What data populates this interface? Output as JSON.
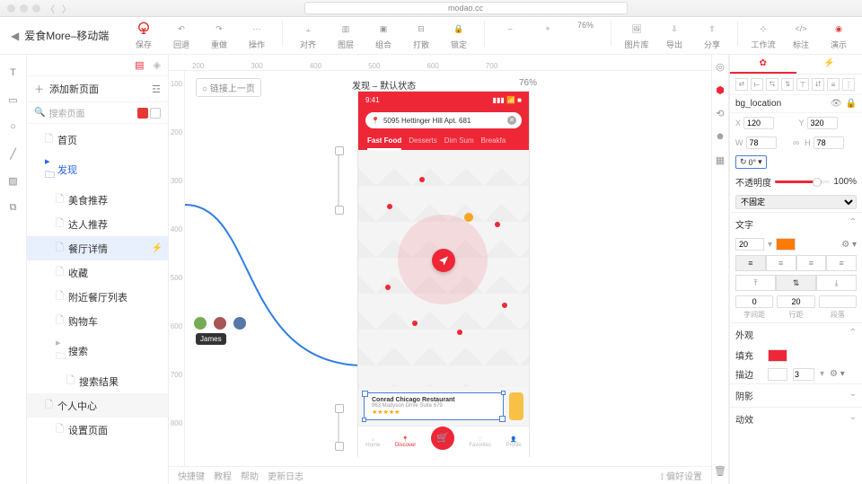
{
  "browser": {
    "url": "modao.cc"
  },
  "appTitle": "爱食More–移动端",
  "toolbar": {
    "save": "保存",
    "back": "回退",
    "redo": "重做",
    "ops": "操作",
    "align": "对齐",
    "layers": "图层",
    "group": "组合",
    "break": "打散",
    "lock": "锁定",
    "zoomOut": "–",
    "zoomIn": "+",
    "zoom": "76%",
    "lib": "图片库",
    "export": "导出",
    "share": "分享",
    "workflow": "工作流",
    "annotate": "标注",
    "preview": "演示"
  },
  "side": {
    "addPage": "添加新页面",
    "search": "搜索页面",
    "items": [
      {
        "label": "首页",
        "kind": "page"
      },
      {
        "label": "发现",
        "kind": "folder",
        "blue": true
      },
      {
        "label": "美食推荐",
        "kind": "page",
        "child": true
      },
      {
        "label": "达人推荐",
        "kind": "page",
        "child": true
      },
      {
        "label": "餐厅详情",
        "kind": "page",
        "child": true,
        "sel": true
      },
      {
        "label": "收藏",
        "kind": "page",
        "child": true
      },
      {
        "label": "附近餐厅列表",
        "kind": "page",
        "child": true
      },
      {
        "label": "购物车",
        "kind": "page",
        "child": true
      },
      {
        "label": "搜索",
        "kind": "folder",
        "child": true
      },
      {
        "label": "搜索结果",
        "kind": "page",
        "child2": true
      },
      {
        "label": "个人中心",
        "kind": "page",
        "bg": true
      },
      {
        "label": "设置页面",
        "kind": "page",
        "child": true
      }
    ]
  },
  "canvas": {
    "linkPrev": "链接上一页",
    "pageLabel": "发现 – 默认状态",
    "zoom": "76%",
    "avatarTip": "James",
    "rulerH": [
      "200",
      "300",
      "400",
      "500",
      "600",
      "700"
    ],
    "rulerV": [
      "100",
      "200",
      "300",
      "400",
      "500",
      "600",
      "700",
      "800"
    ],
    "phone": {
      "time": "9:41",
      "search": "5095 Hettinger Hill Apt. 681",
      "tabs": [
        "Fast Food",
        "Desserts",
        "Dim Sum",
        "Breakfa"
      ],
      "card": {
        "title": "Conrad Chicago Restaurant",
        "addr": "963 Madyson Drive Suite 679",
        "stars": "★★★★★"
      },
      "nav": [
        "Home",
        "Discover",
        "",
        "Favorites",
        "Profile"
      ]
    },
    "footer": [
      "快捷键",
      "教程",
      "帮助",
      "更新日志"
    ],
    "footerR": "偏好设置"
  },
  "inspector": {
    "name": "bg_location",
    "x": "120",
    "y": "320",
    "w": "78",
    "h": "78",
    "rot": "0°",
    "opacityLbl": "不透明度",
    "opacity": "100%",
    "pin": "不固定",
    "textLbl": "文字",
    "fontSize": "20",
    "spacing": [
      "0",
      "20",
      ""
    ],
    "spacingLbl": [
      "字间距",
      "行距",
      "段落"
    ],
    "appearLbl": "外观",
    "fillLbl": "填充",
    "strokeLbl": "描边",
    "strokeW": "3",
    "shadowLbl": "阴影",
    "fxLbl": "动效"
  }
}
